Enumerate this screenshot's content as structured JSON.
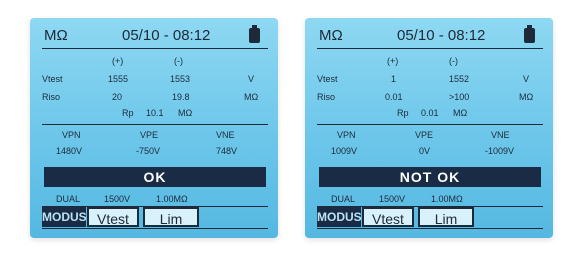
{
  "screens": [
    {
      "unit": "MΩ",
      "datetime": "05/10 - 08:12",
      "battery_icon": "battery-icon",
      "col_plus": "(+)",
      "col_minus": "(-)",
      "vtest_label": "Vtest",
      "vtest_plus": "1555",
      "vtest_minus": "1553",
      "vtest_unit": "V",
      "riso_label": "Riso",
      "riso_plus": "20",
      "riso_minus": "19.8",
      "riso_unit": "MΩ",
      "rp_label": "Rp",
      "rp_value": "10.1",
      "rp_unit": "MΩ",
      "vpn_label": "VPN",
      "vpe_label": "VPE",
      "vne_label": "VNE",
      "vpn_value": "1480V",
      "vpe_value": "-750V",
      "vne_value": "748V",
      "status": "OK",
      "dual_label": "DUAL",
      "dual_voltage": "1500V",
      "dual_resistance": "1.00MΩ",
      "tab_mode": "MODUS",
      "tab_vtest": "Vtest",
      "tab_lim": "Lim"
    },
    {
      "unit": "MΩ",
      "datetime": "05/10 - 08:12",
      "battery_icon": "battery-icon",
      "col_plus": "(+)",
      "col_minus": "(-)",
      "vtest_label": "Vtest",
      "vtest_plus": "1",
      "vtest_minus": "1552",
      "vtest_unit": "V",
      "riso_label": "Riso",
      "riso_plus": "0.01",
      "riso_minus": ">100",
      "riso_unit": "MΩ",
      "rp_label": "Rp",
      "rp_value": "0.01",
      "rp_unit": "MΩ",
      "vpn_label": "VPN",
      "vpe_label": "VPE",
      "vne_label": "VNE",
      "vpn_value": "1009V",
      "vpe_value": "0V",
      "vne_value": "-1009V",
      "status": "NOT  OK",
      "dual_label": "DUAL",
      "dual_voltage": "1500V",
      "dual_resistance": "1.00MΩ",
      "tab_mode": "MODUS",
      "tab_vtest": "Vtest",
      "tab_lim": "Lim"
    }
  ]
}
